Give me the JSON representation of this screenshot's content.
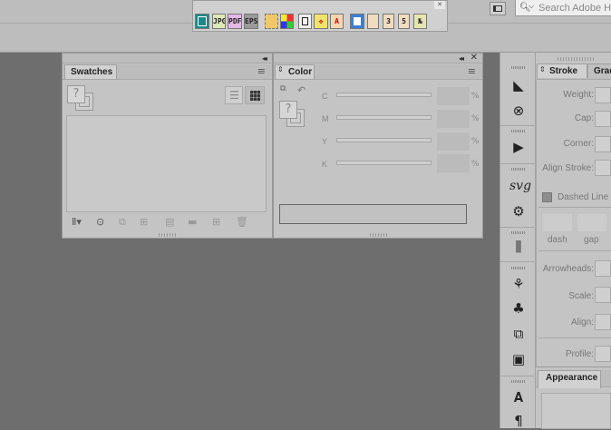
{
  "search": {
    "placeholder": "Search Adobe He"
  },
  "quickbar": {
    "buttons": [
      "JPG",
      "PDF",
      "EPS",
      "3",
      "5",
      "№",
      "A"
    ]
  },
  "swatches": {
    "tab_label": "Swatches"
  },
  "color": {
    "tab_label": "Color",
    "channels": [
      {
        "label": "C",
        "unit": "%"
      },
      {
        "label": "M",
        "unit": "%"
      },
      {
        "label": "Y",
        "unit": "%"
      },
      {
        "label": "K",
        "unit": "%"
      }
    ]
  },
  "tools": {
    "svg_label": "svg"
  },
  "stroke": {
    "tab_label": "Stroke",
    "tab2_label": "Grad",
    "weight_label": "Weight:",
    "cap_label": "Cap:",
    "corner_label": "Corner:",
    "align_label": "Align Stroke:",
    "dashed_label": "Dashed Line",
    "dash_label": "dash",
    "gap_label": "gap",
    "arrowheads_label": "Arrowheads:",
    "scale_label": "Scale:",
    "align2_label": "Align:",
    "profile_label": "Profile:"
  },
  "appearance": {
    "tab_label": "Appearance"
  },
  "icons": {
    "question_mark": "?"
  }
}
